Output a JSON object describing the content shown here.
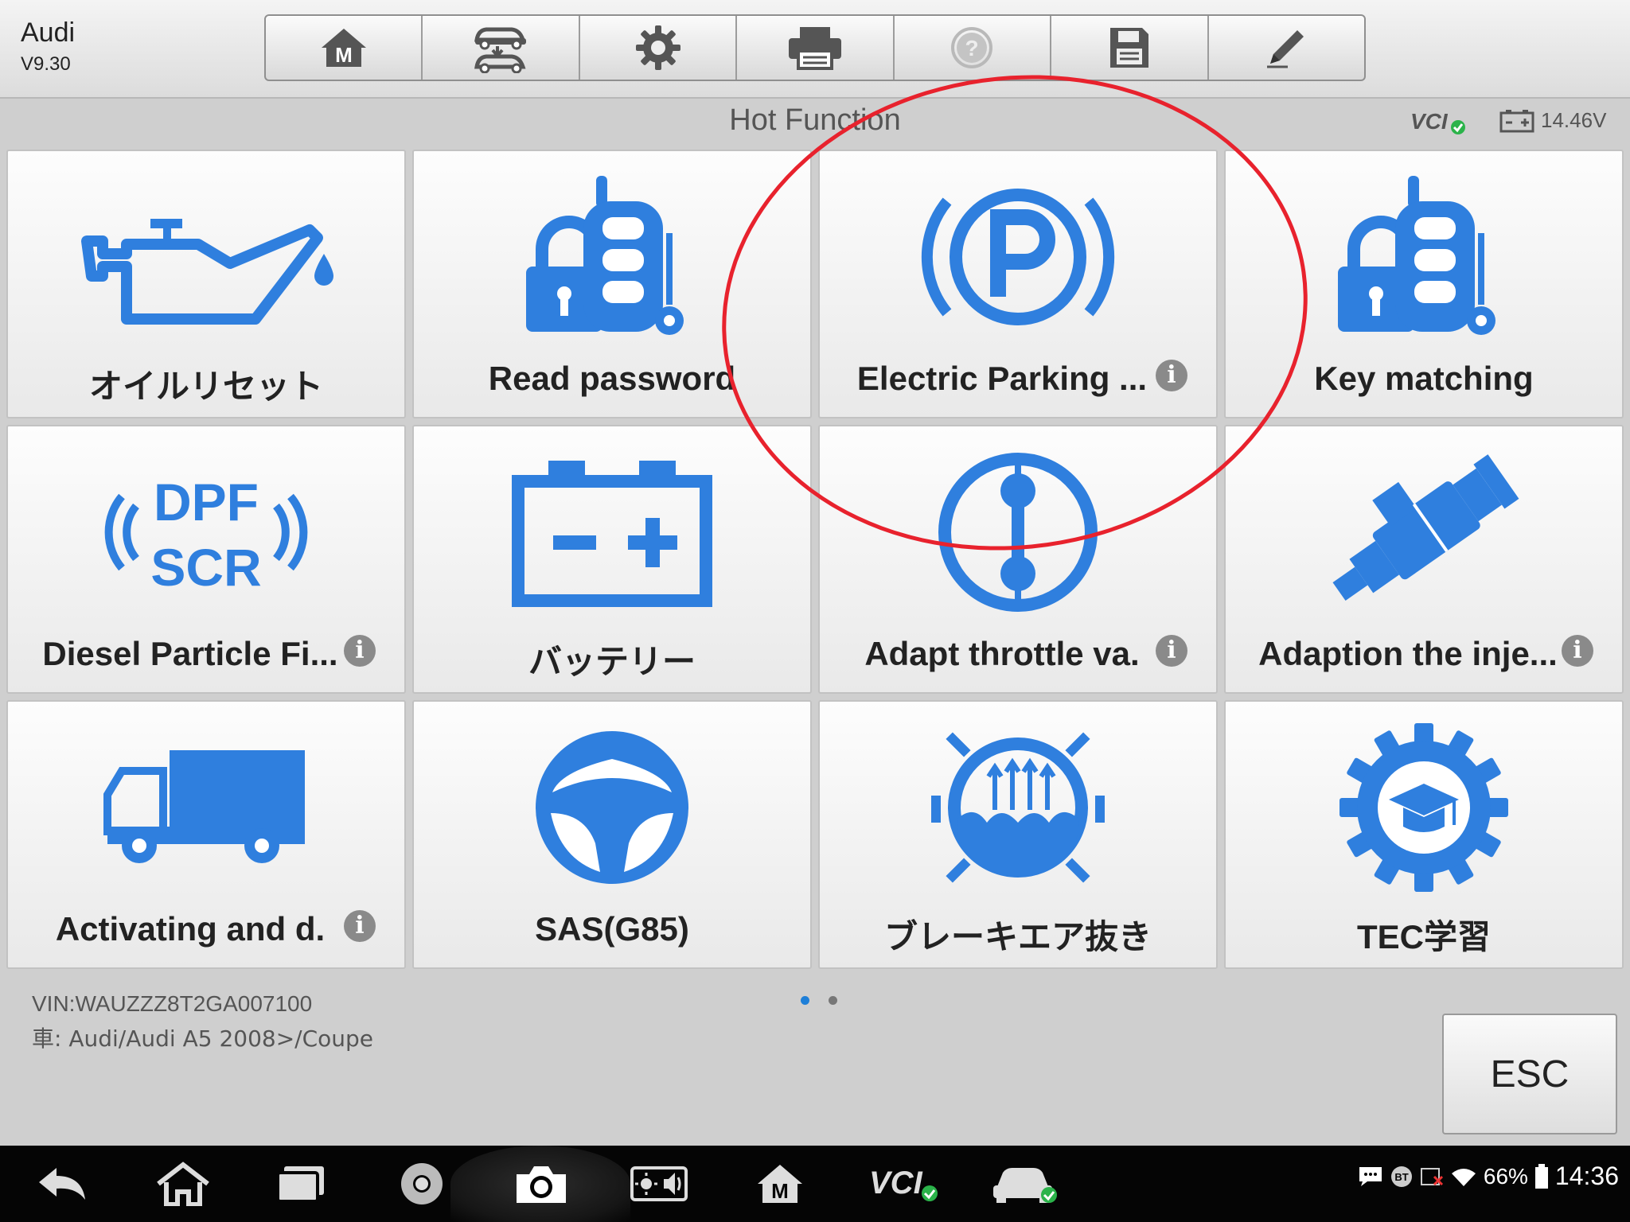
{
  "header": {
    "make": "Audi",
    "version": "V9.30",
    "toolbar": [
      {
        "name": "home-m-button",
        "icon": "m-home-icon"
      },
      {
        "name": "vehicle-swap-button",
        "icon": "vehicle-swap-icon"
      },
      {
        "name": "settings-button",
        "icon": "gear-icon"
      },
      {
        "name": "print-button",
        "icon": "printer-icon"
      },
      {
        "name": "help-button",
        "icon": "help-icon",
        "disabled": true
      },
      {
        "name": "save-button",
        "icon": "floppy-icon"
      },
      {
        "name": "edit-button",
        "icon": "pencil-icon"
      }
    ]
  },
  "titlebar": {
    "title": "Hot Function",
    "vci_label": "VCI",
    "voltage": "14.46V"
  },
  "tiles": [
    {
      "label": "オイルリセット",
      "icon": "oil-can-icon",
      "info": false
    },
    {
      "label": "Read password",
      "icon": "key-fob-password-icon",
      "info": false
    },
    {
      "label": "Electric Parking ...",
      "icon": "parking-brake-icon",
      "info": true
    },
    {
      "label": "Key matching",
      "icon": "key-fob-icon",
      "info": false
    },
    {
      "label": "Diesel Particle Fi...",
      "icon": "dpf-scr-icon",
      "info": true,
      "icon_text_top": "DPF",
      "icon_text_bottom": "SCR"
    },
    {
      "label": "バッテリー",
      "icon": "battery-icon",
      "info": false
    },
    {
      "label": "Adapt throttle va.",
      "icon": "throttle-valve-icon",
      "info": true
    },
    {
      "label": "Adaption the inje...",
      "icon": "injector-icon",
      "info": true
    },
    {
      "label": "Activating and d.",
      "icon": "truck-icon",
      "info": true
    },
    {
      "label": "SAS(G85)",
      "icon": "steering-wheel-icon",
      "info": false
    },
    {
      "label": "ブレーキエア抜き",
      "icon": "brake-bleed-icon",
      "info": false
    },
    {
      "label": "TEC学習",
      "icon": "tec-learning-gear-icon",
      "info": false
    }
  ],
  "info_glyph": "i",
  "footer": {
    "vin": "VIN:WAUZZZ8T2GA007100",
    "vehicle": "車: Audi/Audi A5 2008>/Coupe",
    "esc_label": "ESC",
    "pages": 2,
    "current_page": 1
  },
  "sysbar": {
    "icons": [
      "back-icon",
      "home-icon",
      "recent-apps-icon",
      "chrome-icon",
      "camera-icon",
      "brightness-volume-icon",
      "maxisys-icon",
      "vci-icon",
      "vehicle-status-icon"
    ],
    "vci_text": "VCI",
    "bt_text": "BT",
    "battery_percent": "66%",
    "time": "14:36"
  },
  "colors": {
    "icon_blue": "#2f7fde",
    "highlight_red": "#e8222d",
    "check_green": "#2bb34a"
  }
}
